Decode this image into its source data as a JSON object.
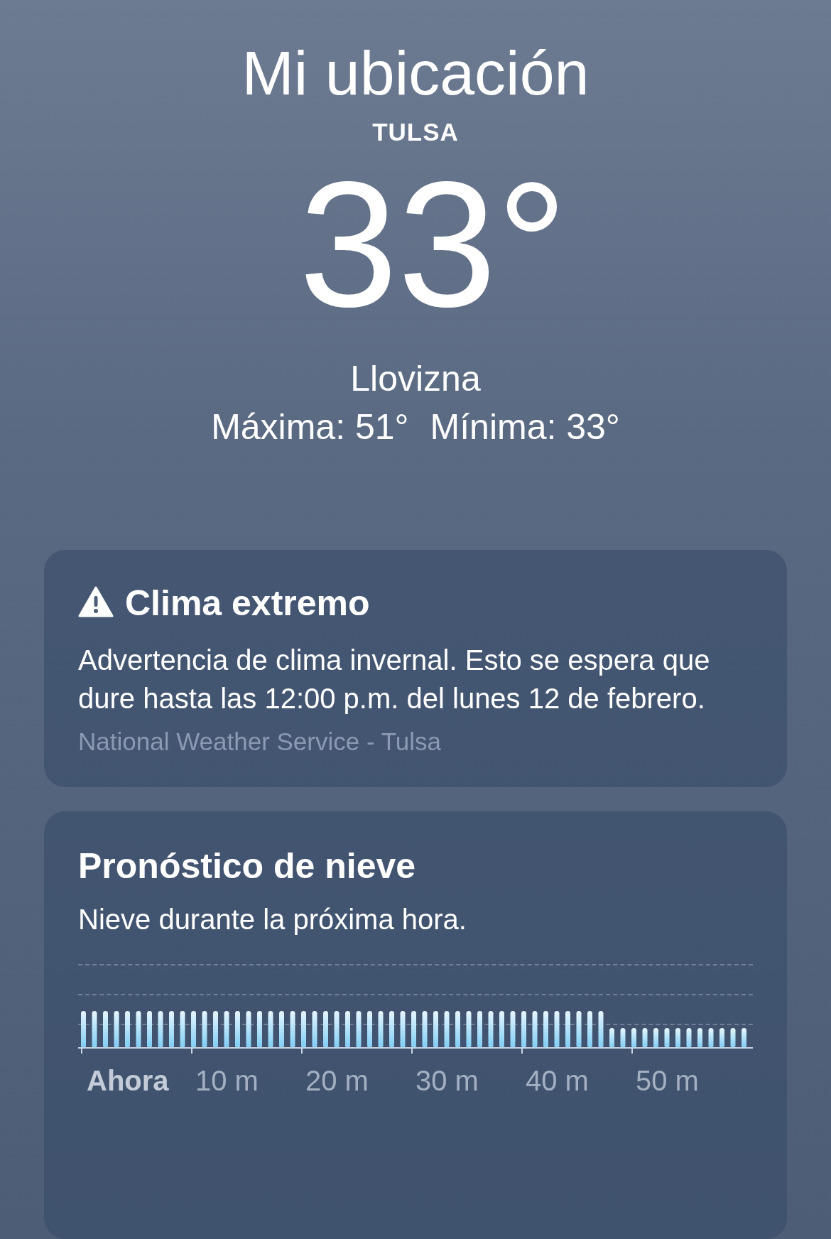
{
  "location": {
    "title": "Mi ubicación",
    "city": "TULSA",
    "temperature": "33°",
    "condition": "Llovizna",
    "high": "Máxima: 51°",
    "low": "Mínima: 33°"
  },
  "alert": {
    "title": "Clima extremo",
    "body": "Advertencia de clima invernal. Esto se espera que dure hasta las 12:00 p.m. del lunes 12 de febrero.",
    "source": "National Weather Service - Tulsa"
  },
  "snow_forecast": {
    "title": "Pronóstico de nieve",
    "summary": "Nieve durante la próxima hora.",
    "axis_labels": [
      {
        "label": "Ahora",
        "selected": true
      },
      {
        "label": "10 m",
        "selected": false
      },
      {
        "label": "20 m",
        "selected": false
      },
      {
        "label": "30 m",
        "selected": false
      },
      {
        "label": "40 m",
        "selected": false
      },
      {
        "label": "50 m",
        "selected": false
      }
    ]
  }
}
